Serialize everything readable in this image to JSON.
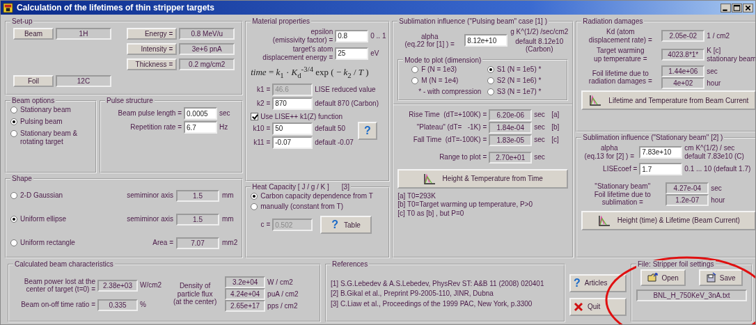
{
  "window": {
    "title": "Calculation of the lifetimes of thin stripper targets"
  },
  "setup": {
    "title": "Set-up",
    "items": [
      {
        "button": "Beam",
        "value": "1H"
      },
      {
        "button": "Foil",
        "value": "12C"
      }
    ],
    "params": [
      {
        "label": "Energy =",
        "value": "0.8 MeV/u"
      },
      {
        "label": "Intensity =",
        "value": "3e+6 pnA"
      },
      {
        "label": "Thickness =",
        "value": "0.2 mg/cm2"
      }
    ]
  },
  "beam_options": {
    "title": "Beam options",
    "options": [
      {
        "label": "Stationary beam",
        "selected": false
      },
      {
        "label": "Pulsing beam",
        "selected": true
      },
      {
        "label": "Stationary beam & rotating target",
        "selected": false
      }
    ]
  },
  "pulse_structure": {
    "title": "Pulse structure",
    "fields": [
      {
        "label": "Beam pulse length =",
        "value": "0.0005",
        "unit": "sec"
      },
      {
        "label": "Repetition rate =",
        "value": "6.7",
        "unit": "Hz"
      }
    ]
  },
  "shape": {
    "title": "Shape",
    "options": [
      {
        "label": "2-D Gaussian",
        "selected": false,
        "field_label": "semiminor axis",
        "value": "1.5",
        "unit": "mm"
      },
      {
        "label": "Uniform ellipse",
        "selected": true,
        "field_label": "semiminor axis",
        "value": "1.5",
        "unit": "mm"
      },
      {
        "label": "Uniform rectangle",
        "selected": false,
        "field_label": "Area =",
        "value": "7.07",
        "unit": "mm2"
      }
    ]
  },
  "material": {
    "title": "Material properties",
    "fields": [
      {
        "label": [
          "epsilon",
          "(emissivity factor) ="
        ],
        "value": "0.8",
        "hint": "0 .. 1"
      },
      {
        "label": [
          "target's atom",
          "displacement energy ="
        ],
        "value": "25",
        "hint": "eV"
      }
    ],
    "formula": "*time* = *k*$_{1}$ · *K*$_{d}$$^{-3/4}$ exp ( − *k*$_{2}$ / *T* )",
    "k_fields": [
      {
        "label": "k1 =",
        "value": "46.6",
        "disabled": true,
        "note": "LISE reduced value"
      },
      {
        "label": "k2 =",
        "value": "870",
        "disabled": false,
        "note": "default 870 (Carbon)"
      }
    ],
    "use_function": {
      "label": "Use LISE++ k1(Z) function",
      "checked": true
    },
    "help_button": "?",
    "k1_fields": [
      {
        "label": "k10 =",
        "value": "50",
        "note": "default 50"
      },
      {
        "label": "k11 =",
        "value": "-0.07",
        "note": "default -0.07"
      }
    ]
  },
  "heat_capacity": {
    "title": "Heat Capacity [ J / g / K ]",
    "ref": "[3]",
    "options": [
      {
        "label": "Carbon capacity dependence from T",
        "selected": true
      },
      {
        "label": "manually (constant from T)",
        "selected": false
      }
    ],
    "c_field": {
      "label": "c =",
      "value": "0.502",
      "disabled": true
    },
    "table_button": {
      "icon": "?",
      "label": "Table"
    }
  },
  "sublimation_pulsing": {
    "title": "Sublimation influence (\"Pulsing beam\" case [1] )",
    "alpha_label": [
      "alpha",
      "(eq.22 for [1] ) ="
    ],
    "alpha": "8.12e+10",
    "alpha_unit": "g K^(1/2) /sec/cm2",
    "alpha_default": [
      "default 8.12e10",
      "(Carbon)"
    ],
    "mode": {
      "title": "Mode to plot (dimension)",
      "options": [
        {
          "label": "F (N = 1e3)",
          "selected": false
        },
        {
          "label": "M (N = 1e4)",
          "selected": false
        },
        {
          "label": "S1 (N = 1e5) *",
          "selected": true
        },
        {
          "label": "S2 (N = 1e6) *",
          "selected": false
        },
        {
          "label": "S3 (N = 1e7) *",
          "selected": false
        }
      ],
      "note": "* - with compression"
    },
    "times": [
      {
        "label": "Rise Time  (dT=+100K) =",
        "value": "6.20e-06",
        "unit": "sec",
        "ref": "[a]"
      },
      {
        "label": "\"Plateau\" (dT=   -1K) =",
        "value": "1.84e-04",
        "unit": "sec",
        "ref": "[b]"
      },
      {
        "label": "Fall Time  (dT=-100K) =",
        "value": "1.83e-05",
        "unit": "sec",
        "ref": "[c]"
      }
    ],
    "range": {
      "label": "Range to plot =",
      "value": "2.70e+01",
      "unit": "sec"
    },
    "button": "Height  & Temperature from Time",
    "notes": [
      "[a]  T0=293K",
      "[b]  T0=Target warming up temperature, P>0",
      "[c]  T0 as [b] , but P=0"
    ]
  },
  "radiation": {
    "title": "Radiation damages",
    "kd_label": [
      "Kd   (atom",
      "displacement rate) ="
    ],
    "kd": "2.05e-02",
    "kd_unit": "1 / cm2",
    "temp_label": [
      "Target warming",
      "up temperature ="
    ],
    "temp": "4023.8*1*",
    "temp_unit": [
      "K     [c]",
      "stationary beam"
    ],
    "life_label": [
      "Foil lifetime due to",
      "radiation damages ="
    ],
    "life": [
      {
        "value": "1.44e+06",
        "unit": "sec"
      },
      {
        "value": "4e+02",
        "unit": "hour"
      }
    ],
    "button": "Lifetime and Temperature from Beam Current"
  },
  "sublimation_stationary": {
    "title": "Sublimation influence (\"Stationary beam\" [2] )",
    "alpha_label": [
      "alpha",
      "(eq.13 for [2] ) ="
    ],
    "alpha": "7.83e+10",
    "alpha_unit": [
      "cm K^(1/2) / sec",
      "default 7.83e10 (C)"
    ],
    "coef_label": "LISEcoef =",
    "coef": "1.7",
    "coef_note": "0.1 ... 10 (default 1.7)",
    "life_label": [
      "\"Stationary beam\"",
      "Foil lifetime due to",
      "sublimation ="
    ],
    "life": [
      {
        "value": "4.27e-04",
        "unit": "sec"
      },
      {
        "value": "1.2e-07",
        "unit": "hour"
      }
    ],
    "button": "Height (time)  & Lifetime (Beam Current)"
  },
  "calculated": {
    "title": "Calculated beam characteristics",
    "power_label": [
      "Beam power lost at the",
      "center of target (t=0) ="
    ],
    "power": "2.38e+03",
    "power_unit": "W/cm2",
    "ratio_label": "Beam on-off time ratio =",
    "ratio": "0.335",
    "ratio_unit": "%",
    "density_label": [
      "Density of",
      "particle flux",
      "(at the center)"
    ],
    "density": [
      {
        "value": "3.2e+04",
        "unit": "W  / cm2"
      },
      {
        "value": "4.24e+04",
        "unit": "puA / cm2"
      },
      {
        "value": "2.65e+17",
        "unit": "pps / cm2"
      }
    ]
  },
  "references": {
    "title": "References",
    "items": [
      "[1] S.G.Lebedev & A.S.Lebedev, PhysRev ST: A&B 11 (2008) 020401",
      "[2] B.Gikal et al., Preprint  P9-2005-110, JINR, Dubna",
      "[3] C.Liaw et al., Proceedings of the 1999 PAC, New York, p.3300"
    ]
  },
  "actions": [
    {
      "kind": "help",
      "icon": "?",
      "label": "Articles"
    },
    {
      "kind": "quit",
      "label": "Quit"
    }
  ],
  "file": {
    "title": "File: Stripper foil settings",
    "buttons": [
      {
        "kind": "open",
        "label": "Open"
      },
      {
        "kind": "save",
        "label": "Save"
      }
    ],
    "filename": "BNL_H_750KeV_3nA.txt"
  }
}
